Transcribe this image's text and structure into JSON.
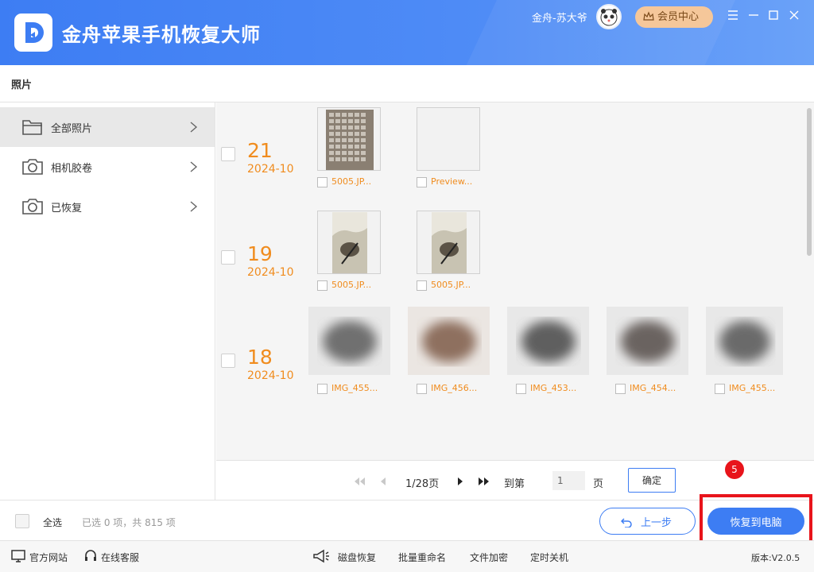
{
  "app": {
    "title": "金舟苹果手机恢复大师",
    "username": "金舟-苏大爷",
    "vip_label": "会员中心",
    "colors": {
      "primary": "#3d7df3",
      "accent_orange": "#f08c1e",
      "highlight_red": "#e8141b",
      "vip_gold": "#f5c79a"
    }
  },
  "window_controls": [
    "menu-icon",
    "minimize-icon",
    "maximize-icon",
    "close-icon"
  ],
  "section": {
    "title": "照片"
  },
  "sidebar": {
    "items": [
      {
        "label": "全部照片",
        "icon": "folder-icon",
        "active": true
      },
      {
        "label": "相机胶卷",
        "icon": "camera-icon",
        "active": false
      },
      {
        "label": "已恢复",
        "icon": "camera-icon",
        "active": false
      }
    ]
  },
  "groups": [
    {
      "day": "21",
      "month": "2024-10",
      "files": [
        {
          "name": "5005.JP..."
        },
        {
          "name": "Preview..."
        }
      ]
    },
    {
      "day": "19",
      "month": "2024-10",
      "files": [
        {
          "name": "5005.JP..."
        },
        {
          "name": "5005.JP..."
        }
      ]
    },
    {
      "day": "18",
      "month": "2024-10",
      "files": [
        {
          "name": "IMG_455..."
        },
        {
          "name": "IMG_456..."
        },
        {
          "name": "IMG_453..."
        },
        {
          "name": "IMG_454..."
        },
        {
          "name": "IMG_455..."
        }
      ]
    }
  ],
  "pager": {
    "page_info": "1/28页",
    "goto_label": "到第",
    "page_value": "1",
    "page_unit": "页",
    "confirm_label": "确定"
  },
  "bottom": {
    "select_all": "全选",
    "status": "已选 0 项，共 815 项",
    "prev_label": "上一步",
    "recover_label": "恢复到电脑",
    "step_badge": "5"
  },
  "footer": {
    "website": "官方网站",
    "support": "在线客服",
    "disk_recovery": "磁盘恢复",
    "batch_rename": "批量重命名",
    "file_encrypt": "文件加密",
    "scheduled_shutdown": "定时关机",
    "version": "版本:V2.0.5"
  }
}
